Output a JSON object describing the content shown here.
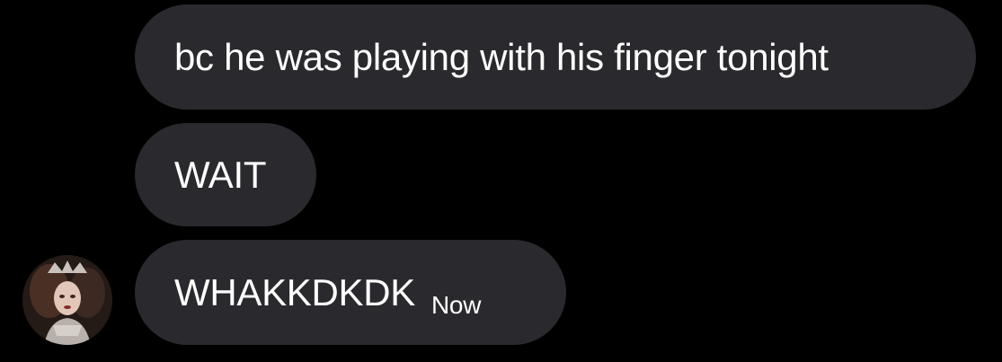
{
  "messages": [
    {
      "text": "bc he was playing with his finger tonight"
    },
    {
      "text": "WAIT"
    },
    {
      "text": "WHAKKDKDK",
      "timestamp": "Now"
    }
  ],
  "avatar": {
    "icon": "user-avatar-photo"
  },
  "colors": {
    "background": "#000000",
    "bubble": "#2a2a2e",
    "text": "#ffffff"
  }
}
